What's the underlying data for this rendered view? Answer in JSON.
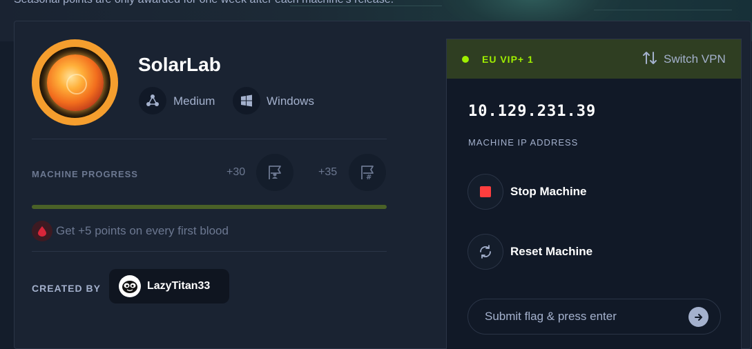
{
  "banner": {
    "text": "Seasonal points are only awarded for one week after each machine's release."
  },
  "machine": {
    "name": "SolarLab",
    "difficulty": "Medium",
    "os": "Windows"
  },
  "progress": {
    "label": "MACHINE PROGRESS",
    "user_points": "+30",
    "root_points": "+35",
    "bar_fraction": 1.0,
    "bar_color": "#4a6127"
  },
  "first_blood": {
    "text": "Get +5 points on every first blood"
  },
  "creator": {
    "label": "CREATED BY",
    "name": "LazyTitan33"
  },
  "vpn": {
    "server": "EU VIP+ 1",
    "status_color": "#9fef00",
    "switch_label": "Switch VPN"
  },
  "target": {
    "ip": "10.129.231.39",
    "ip_label": "MACHINE IP ADDRESS"
  },
  "actions": {
    "stop_label": "Stop Machine",
    "reset_label": "Reset Machine"
  },
  "flag": {
    "placeholder": "Submit flag & press enter"
  },
  "icons": {
    "difficulty": "difficulty-nodes-icon",
    "os": "windows-icon",
    "user_flag": "user-flag-icon",
    "root_flag": "root-flag-icon",
    "blood": "blood-drop-icon",
    "switch": "switch-arrows-icon",
    "stop": "stop-icon",
    "reset": "reset-icon",
    "submit": "arrow-right-icon"
  }
}
